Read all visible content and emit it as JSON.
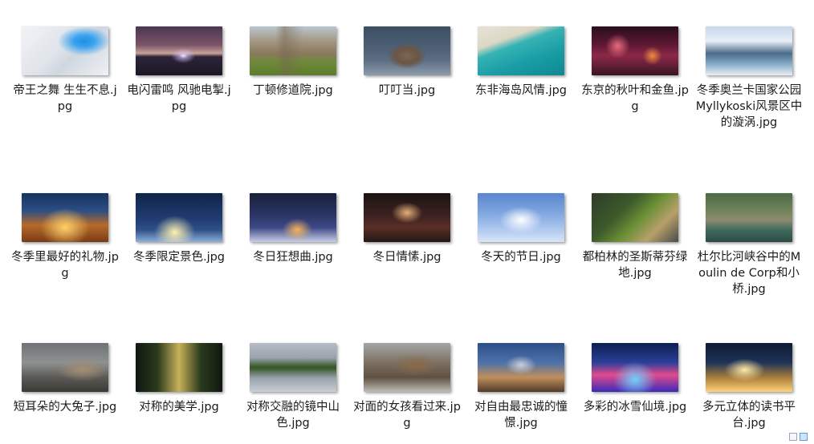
{
  "files": [
    {
      "name": "帝王之舞 生生不息.jpg",
      "thumb": "linear-gradient(135deg,#f1f3f6 0%,#dfe4ea 45%,#cfd7e0 60%,#eef1f4 100%)",
      "accent": "radial-gradient(ellipse at 72% 30%,#1f8ee0 0%,#3aa3ef 12%,rgba(60,160,235,0) 30%)"
    },
    {
      "name": "电闪雷鸣 风驰电掣.jpg",
      "thumb": "linear-gradient(180deg,#4a3550 0%,#7b5566 38%,#c9a19a 55%,#2d2438 62%,#1b1825 100%)",
      "accent": "radial-gradient(ellipse at 55% 60%,#f2e6ff 0%,rgba(220,200,255,0.6) 6%,rgba(0,0,0,0) 18%)"
    },
    {
      "name": "丁顿修道院.jpg",
      "thumb": "linear-gradient(180deg,#b9c6cf 0%,#a49782 30%,#8a7a5e 55%,#6f8a3a 72%,#5c7d2c 100%)",
      "accent": "linear-gradient(90deg,rgba(0,0,0,0) 30%,rgba(120,100,80,0.5) 40%,rgba(0,0,0,0) 62%)"
    },
    {
      "name": "叮叮当.jpg",
      "thumb": "linear-gradient(180deg,#3c4f63 0%,#4d6075 45%,#5d6f84 70%,#8e9cab 100%)",
      "accent": "radial-gradient(ellipse at 50% 60%,#7b6553 0%,#6b5545 18%,rgba(0,0,0,0) 32%)"
    },
    {
      "name": "东非海岛风情.jpg",
      "thumb": "linear-gradient(160deg,#e8e3d6 0%,#dcd7c5 28%,#36b3b4 40%,#1a9ea6 65%,#0f8791 100%)",
      "accent": ""
    },
    {
      "name": "东京的秋叶和金鱼.jpg",
      "thumb": "linear-gradient(180deg,#2a0f1c 0%,#5a1731 35%,#8c2948 60%,#3a1424 100%)",
      "accent": "radial-gradient(circle at 30% 40%,#e66b7d 0%,rgba(0,0,0,0) 18%), radial-gradient(circle at 70% 60%,#f08a3c 0%,rgba(0,0,0,0) 14%)"
    },
    {
      "name": "冬季奥兰卡国家公园Myllykoski风景区中的漩涡.jpg",
      "thumb": "linear-gradient(180deg,#c7d8ea 0%,#e6eef5 30%,#4a6c88 55%,#7fa6c4 75%,#e9eff5 100%)",
      "accent": ""
    },
    {
      "name": "冬季里最好的礼物.jpg",
      "thumb": "linear-gradient(180deg,#17345e 0%,#2a4d84 35%,#b56a2a 65%,#7a3c16 100%)",
      "accent": "radial-gradient(ellipse at 50% 70%,#ffcf6a 0%,rgba(255,180,70,0) 40%)"
    },
    {
      "name": "冬季限定景色.jpg",
      "thumb": "linear-gradient(180deg,#0f2448 0%,#1f3b70 50%,#2e4f88 75%,#8fb0d8 100%)",
      "accent": "radial-gradient(ellipse at 45% 80%,#fff2b0 0%,rgba(255,230,140,0) 30%)"
    },
    {
      "name": "冬日狂想曲.jpg",
      "thumb": "linear-gradient(180deg,#1a1f3a 0%,#2b3567 45%,#3d4886 70%,#c7cfe6 100%)",
      "accent": "radial-gradient(ellipse at 55% 75%,#f3b45a 0%,rgba(240,170,80,0) 22%)"
    },
    {
      "name": "冬日情愫.jpg",
      "thumb": "linear-gradient(180deg,#1b1412 0%,#3b2220 45%,#5a2e26 70%,#241816 100%)",
      "accent": "radial-gradient(ellipse at 50% 40%,#e6b07a 0%,rgba(0,0,0,0) 25%)"
    },
    {
      "name": "冬天的节日.jpg",
      "thumb": "linear-gradient(180deg,#5b86cf 0%,#7fa6e0 40%,#a9c4ee 70%,#d8e5f7 100%)",
      "accent": "radial-gradient(ellipse at 50% 55%,#ffffff 0%,rgba(255,255,255,0) 35%)"
    },
    {
      "name": "都柏林的圣斯蒂芬绿地.jpg",
      "thumb": "linear-gradient(135deg,#2f3a28 0%,#3d5a2a 35%,#6b8f36 55%,#b8a06a 75%,#4a4b47 100%)",
      "accent": ""
    },
    {
      "name": "杜尔比河峡谷中的Moulin de Corp和小桥.jpg",
      "thumb": "linear-gradient(180deg,#4d6a45 0%,#6e8459 35%,#8e8a6f 55%,#3f6a5e 75%,#2c4c43 100%)",
      "accent": ""
    },
    {
      "name": "短耳朵的大兔子.jpg",
      "thumb": "linear-gradient(180deg,#6e7277 0%,#8e918f 40%,#5b5a56 70%,#3a3936 100%)",
      "accent": "radial-gradient(ellipse at 70% 55%,#a58e73 0%,rgba(0,0,0,0) 30%)"
    },
    {
      "name": "对称的美学.jpg",
      "thumb": "linear-gradient(90deg,#101712 0%,#2a3a1c 25%,#c7b05a 50%,#2a3a1c 75%,#101712 100%)",
      "accent": ""
    },
    {
      "name": "对称交融的镜中山色.jpg",
      "thumb": "linear-gradient(180deg,#b6bcc4 0%,#9aa3ad 30%,#3b5a2c 48%,#3b5a2c 52%,#9aa3ad 72%,#c9ced4 100%)",
      "accent": ""
    },
    {
      "name": "对面的女孩看过来.jpg",
      "thumb": "linear-gradient(180deg,#a3a6a4 0%,#7d7163 40%,#5e5142 70%,#c0bcb5 100%)",
      "accent": "radial-gradient(ellipse at 60% 45%,#8a6a48 0%,rgba(0,0,0,0) 30%)"
    },
    {
      "name": "对自由最忠诚的憧憬.jpg",
      "thumb": "linear-gradient(180deg,#2c4f88 0%,#4d71aa 40%,#c08f5a 70%,#523b2a 100%)",
      "accent": "radial-gradient(ellipse at 50% 45%,#c9cfd8 0%,rgba(0,0,0,0) 25%)"
    },
    {
      "name": "多彩的冰雪仙境.jpg",
      "thumb": "linear-gradient(180deg,#0c1f4f 0%,#2b3f9a 40%,#e24a8c 65%,#3a2ab8 100%)",
      "accent": "radial-gradient(ellipse at 50% 75%,#6fd0ff 0%,rgba(0,0,0,0) 35%)"
    },
    {
      "name": "多元立体的读书平台.jpg",
      "thumb": "linear-gradient(180deg,#0f1a33 0%,#1e3358 40%,#a77b3a 70%,#ffd27a 100%)",
      "accent": "radial-gradient(ellipse at 45% 55%,#ffe9a8 0%,rgba(0,0,0,0) 30%)"
    }
  ],
  "view_controls": [
    {
      "name": "details-view"
    },
    {
      "name": "thumbnails-view"
    }
  ]
}
